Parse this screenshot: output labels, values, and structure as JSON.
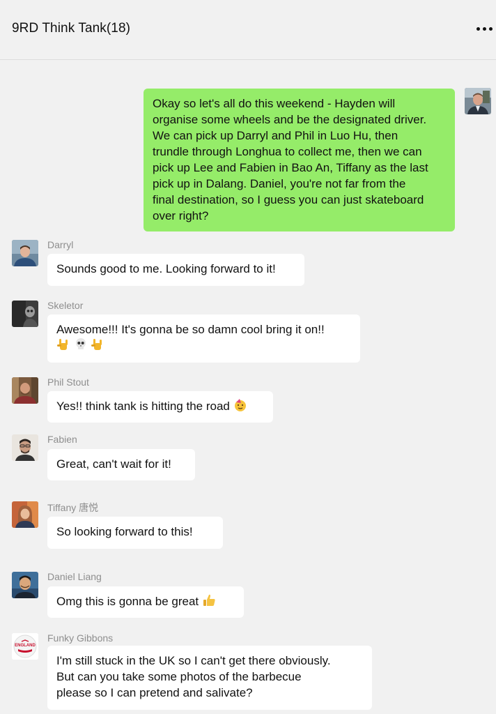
{
  "header": {
    "title": "9RD Think Tank(18)",
    "more_icon": "more-dots-icon"
  },
  "colors": {
    "background": "#f1f1f1",
    "own_bubble": "#95ec69",
    "other_bubble": "#ffffff",
    "sender_name": "#8e8e8e"
  },
  "messages": [
    {
      "sender": "",
      "own": true,
      "lines": [
        "Okay so let's all do this weekend - Hayden will",
        "organise some wheels and be the designated driver.",
        "We can pick up Darryl and Phil in Luo Hu, then",
        "trundle through Longhua to collect me, then we can",
        "pick up Lee and Fabien in Bao An, Tiffany as the last",
        "pick up in Dalang.  Daniel, you're not far from the",
        "final destination, so I guess you can just skateboard",
        "over right?"
      ]
    },
    {
      "sender": "Darryl",
      "lines": [
        "Sounds good to me. Looking forward to it!"
      ]
    },
    {
      "sender": "Skeletor",
      "lines": [
        "Awesome!!! It's gonna be so damn cool  bring it on!!"
      ],
      "emoji_line": [
        "rock-on-hand-icon",
        "skull-icon",
        "rock-on-hand-icon"
      ]
    },
    {
      "sender": "Phil Stout",
      "lines": [
        "Yes!! think tank is hitting the road"
      ],
      "emoji": "party-face-icon"
    },
    {
      "sender": "Fabien",
      "lines": [
        "Great, can't wait for it!"
      ]
    },
    {
      "sender": "Tiffany 唐悦",
      "lines": [
        "So looking forward to this!"
      ]
    },
    {
      "sender": "Daniel Liang",
      "lines": [
        "Omg this is gonna be great"
      ],
      "emoji": "thumbs-up-icon"
    },
    {
      "sender": "Funky Gibbons",
      "lines": [
        "I'm still stuck in the UK so I can't get there obviously.",
        "But can you take some photos of the barbecue",
        "please so I can pretend and salivate?"
      ],
      "avatar_text": "ENGLAND"
    }
  ]
}
